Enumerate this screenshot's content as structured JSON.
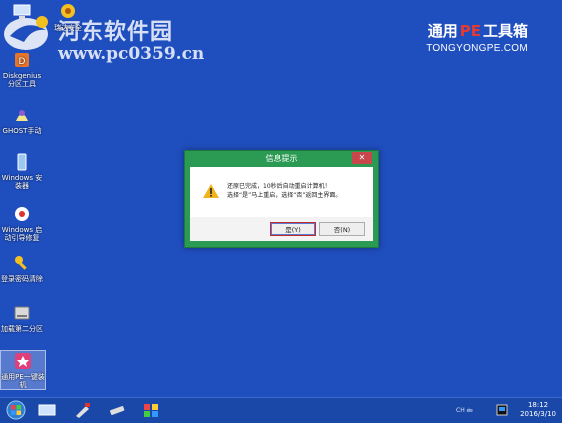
{
  "watermark": {
    "title": "河东软件园",
    "url": "www.pc0359.cn"
  },
  "brand": {
    "main_pre": "通用",
    "main_pe": "PE",
    "main_post": "工具箱",
    "sub": "TONGYONGPE.COM"
  },
  "desktop_icons": [
    {
      "label": "Diskgenius 分区工具"
    },
    {
      "label": "GHOST手动"
    },
    {
      "label": "Windows 安装器"
    },
    {
      "label": "Windows 启动引导修复"
    },
    {
      "label": "登录密码清除"
    },
    {
      "label": "加载第二分区"
    },
    {
      "label": "通用PE一键装机"
    }
  ],
  "top_icons": {
    "label": "瑞达安全"
  },
  "dialog": {
    "title": "信息提示",
    "close": "✕",
    "message_line1": "还原已完成，10秒后自动重启计算机！",
    "message_line2": "选择“是”马上重启，选择“否”返回主界面。",
    "yes_label": "是(Y)",
    "no_label": "否(N)"
  },
  "taskbar": {
    "tray_text": "CH 🖮",
    "time": "18:12",
    "date": "2016/3/10"
  },
  "colors": {
    "desktop": "#1f4ebf",
    "dialog_green": "#2b9a52",
    "close_red": "#c9464a",
    "brand_pe": "#e7392e"
  }
}
